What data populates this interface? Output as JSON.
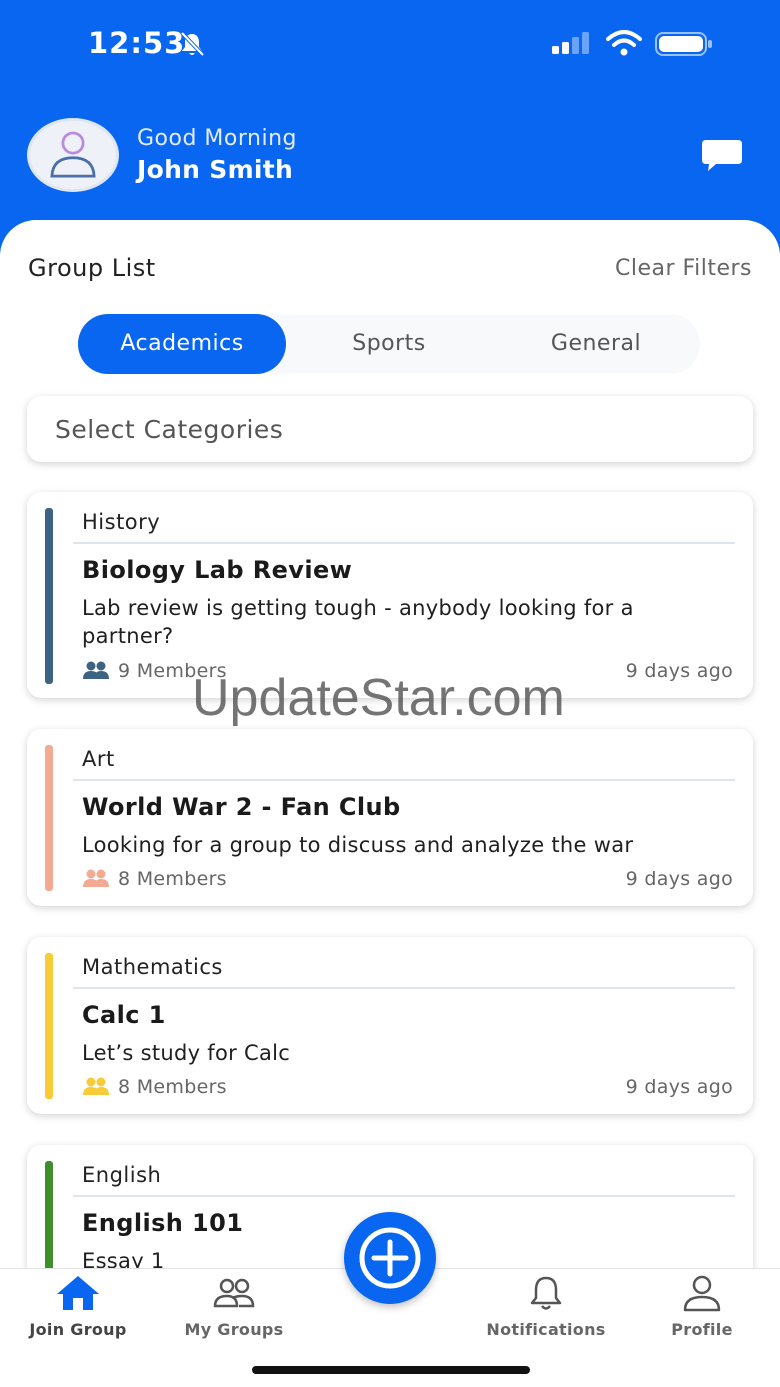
{
  "status": {
    "time": "12:53"
  },
  "header": {
    "greeting": "Good Morning",
    "user_name": "John Smith"
  },
  "page": {
    "title": "Group List",
    "clear_filters": "Clear Filters"
  },
  "tabs": [
    {
      "label": "Academics",
      "active": true
    },
    {
      "label": "Sports",
      "active": false
    },
    {
      "label": "General",
      "active": false
    }
  ],
  "category_select": {
    "placeholder": "Select Categories"
  },
  "groups": [
    {
      "category": "History",
      "title": "Biology Lab Review",
      "description": "Lab review is getting tough - anybody looking for a partner?",
      "members": "9 Members",
      "time": "9 days ago",
      "color": "#3d6384"
    },
    {
      "category": "Art",
      "title": "World War 2 - Fan Club",
      "description": "Looking for a group to discuss and analyze the war",
      "members": "8 Members",
      "time": "9 days ago",
      "color": "#f2ab92"
    },
    {
      "category": "Mathematics",
      "title": "Calc 1",
      "description": "Let’s study for Calc",
      "members": "8 Members",
      "time": "9 days ago",
      "color": "#f8cc36"
    },
    {
      "category": "English",
      "title": "English 101",
      "description": "Essay 1",
      "members": "",
      "time": "",
      "color": "#3c8f2b"
    }
  ],
  "watermark": "UpdateStar.com",
  "nav": [
    {
      "label": "Join Group",
      "icon": "home-icon",
      "active": true
    },
    {
      "label": "My Groups",
      "icon": "groups-icon",
      "active": false
    },
    {
      "label": "Notifications",
      "icon": "bell-icon",
      "active": false
    },
    {
      "label": "Profile",
      "icon": "person-icon",
      "active": false
    }
  ],
  "colors": {
    "primary": "#0866f0"
  }
}
